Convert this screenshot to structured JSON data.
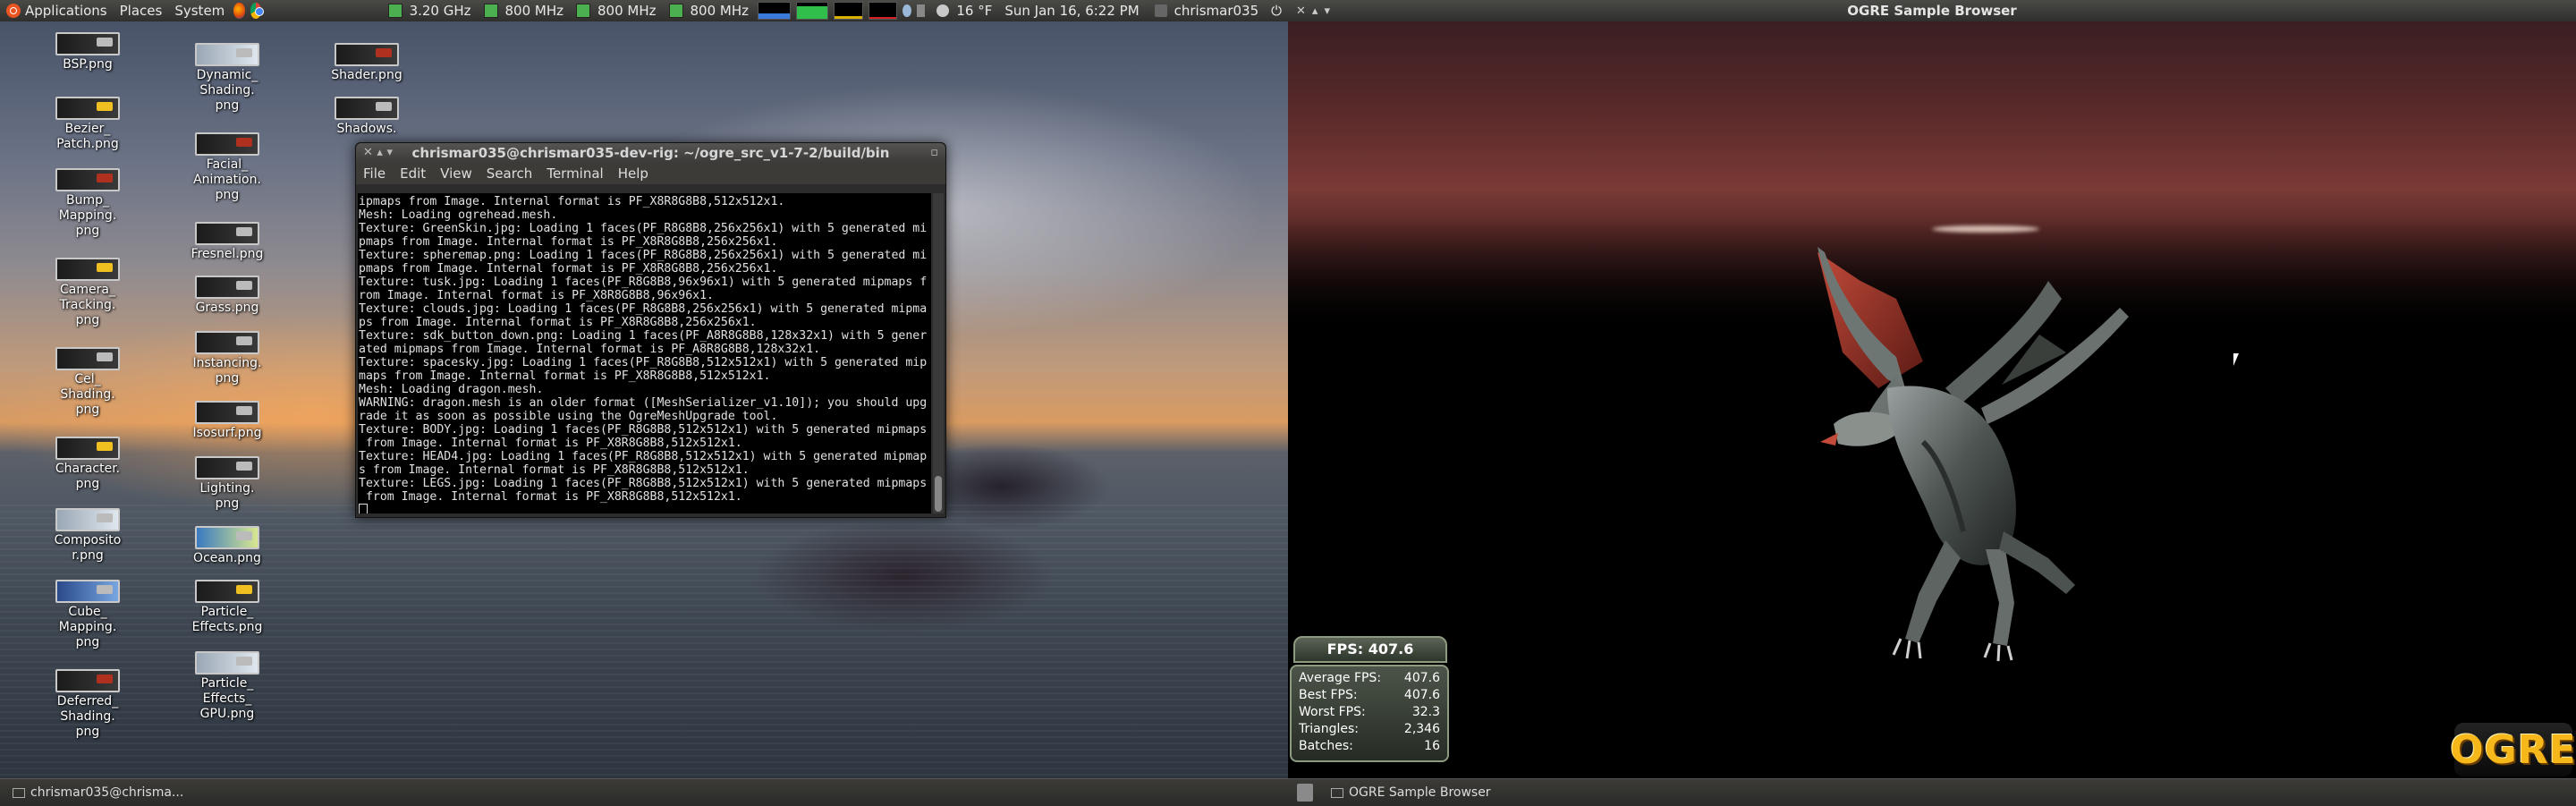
{
  "top_panel": {
    "menus": [
      "Applications",
      "Places",
      "System"
    ],
    "cpu_freqs": [
      "3.20 GHz",
      "800 MHz",
      "800 MHz",
      "800 MHz"
    ],
    "weather": "16 °F",
    "datetime": "Sun Jan 16,  6:22 PM",
    "user": "chrismar035"
  },
  "desktop_icons": [
    {
      "label": "BSP.png"
    },
    {
      "label": "Bezier_\nPatch.png"
    },
    {
      "label": "Bump_\nMapping.\npng"
    },
    {
      "label": "Camera_\nTracking.\npng"
    },
    {
      "label": "Cel_\nShading.\npng"
    },
    {
      "label": "Character.\npng"
    },
    {
      "label": "Composito\nr.png"
    },
    {
      "label": "Cube_\nMapping.\npng"
    },
    {
      "label": "Deferred_\nShading.\npng"
    },
    {
      "label": "Dynamic_\nShading.\npng"
    },
    {
      "label": "Facial_\nAnimation.\npng"
    },
    {
      "label": "Fresnel.png"
    },
    {
      "label": "Grass.png"
    },
    {
      "label": "Instancing.\npng"
    },
    {
      "label": "Isosurf.png"
    },
    {
      "label": "Lighting.\npng"
    },
    {
      "label": "Ocean.png"
    },
    {
      "label": "Particle_\nEffects.png"
    },
    {
      "label": "Particle_\nEffects_\nGPU.png"
    },
    {
      "label": "Shader.png"
    },
    {
      "label": "Shadows."
    }
  ],
  "terminal": {
    "title": "chrismar035@chrismar035-dev-rig: ~/ogre_src_v1-7-2/build/bin",
    "menu": [
      "File",
      "Edit",
      "View",
      "Search",
      "Terminal",
      "Help"
    ],
    "lines": [
      "ipmaps from Image. Internal format is PF_X8R8G8B8,512x512x1.",
      "Mesh: Loading ogrehead.mesh.",
      "Texture: GreenSkin.jpg: Loading 1 faces(PF_R8G8B8,256x256x1) with 5 generated mi",
      "pmaps from Image. Internal format is PF_X8R8G8B8,256x256x1.",
      "Texture: spheremap.png: Loading 1 faces(PF_R8G8B8,256x256x1) with 5 generated mi",
      "pmaps from Image. Internal format is PF_X8R8G8B8,256x256x1.",
      "Texture: tusk.jpg: Loading 1 faces(PF_R8G8B8,96x96x1) with 5 generated mipmaps f",
      "rom Image. Internal format is PF_X8R8G8B8,96x96x1.",
      "Texture: clouds.jpg: Loading 1 faces(PF_R8G8B8,256x256x1) with 5 generated mipma",
      "ps from Image. Internal format is PF_X8R8G8B8,256x256x1.",
      "Texture: sdk_button_down.png: Loading 1 faces(PF_A8R8G8B8,128x32x1) with 5 gener",
      "ated mipmaps from Image. Internal format is PF_A8R8G8B8,128x32x1.",
      "Texture: spacesky.jpg: Loading 1 faces(PF_R8G8B8,512x512x1) with 5 generated mip",
      "maps from Image. Internal format is PF_X8R8G8B8,512x512x1.",
      "Mesh: Loading dragon.mesh.",
      "WARNING: dragon.mesh is an older format ([MeshSerializer_v1.10]); you should upg",
      "rade it as soon as possible using the OgreMeshUpgrade tool.",
      "Texture: BODY.jpg: Loading 1 faces(PF_R8G8B8,512x512x1) with 5 generated mipmaps",
      " from Image. Internal format is PF_X8R8G8B8,512x512x1.",
      "Texture: HEAD4.jpg: Loading 1 faces(PF_R8G8B8,512x512x1) with 5 generated mipmap",
      "s from Image. Internal format is PF_X8R8G8B8,512x512x1.",
      "Texture: LEGS.jpg: Loading 1 faces(PF_R8G8B8,512x512x1) with 5 generated mipmaps",
      " from Image. Internal format is PF_X8R8G8B8,512x512x1."
    ]
  },
  "ogre_window": {
    "title": "OGRE Sample Browser",
    "fps_label": "FPS: 407.6",
    "stats": [
      {
        "label": "Average FPS:",
        "value": "407.6"
      },
      {
        "label": "Best FPS:",
        "value": "407.6"
      },
      {
        "label": "Worst FPS:",
        "value": "32.3"
      },
      {
        "label": "Triangles:",
        "value": "2,346"
      },
      {
        "label": "Batches:",
        "value": "16"
      }
    ],
    "logo_text": "OGRE"
  },
  "taskbar_left": {
    "task": "chrismar035@chrisma..."
  },
  "taskbar_right": {
    "task": "OGRE Sample Browser"
  }
}
